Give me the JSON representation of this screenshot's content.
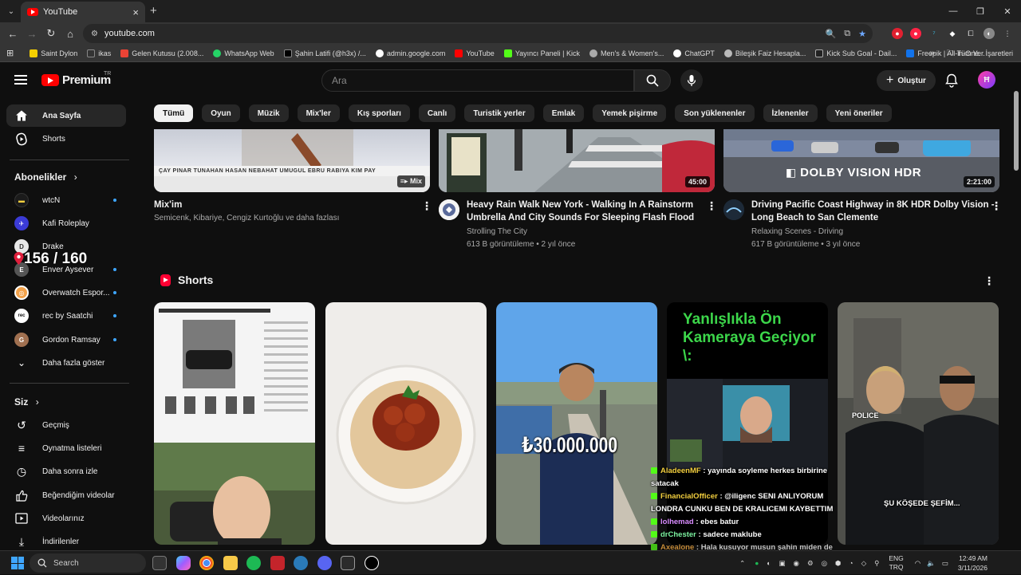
{
  "browser": {
    "tab_title": "YouTube",
    "url": "youtube.com",
    "bookmarks": [
      "Saint Dylon",
      "ikas",
      "Gelen Kutusu (2.008...",
      "WhatsApp Web",
      "Şahin Latifi (@h3x) /...",
      "admin.google.com",
      "YouTube",
      "Yayıncı Paneli | Kick",
      "Men's & Women's...",
      "ChatGPT",
      "Bileşik Faiz Hesapla...",
      "Kick Sub Goal - Dail...",
      "Freepik | All-in-One..."
    ],
    "bookmarks_more": "»",
    "all_bookmarks": "Tüm Yer İşaretleri",
    "colors": {
      "chrome_dark": "#1f1f1f",
      "chrome_mid": "#353535"
    }
  },
  "header": {
    "logo_text": "Premium",
    "logo_region": "TR",
    "search_placeholder": "Ara",
    "create_label": "Oluştur",
    "avatar_letter": "Ħ"
  },
  "sidebar": {
    "main": [
      {
        "label": "Ana Sayfa",
        "icon": "home-icon"
      },
      {
        "label": "Shorts",
        "icon": "shorts-icon"
      }
    ],
    "subs_heading": "Abonelikler",
    "subs": [
      {
        "label": "wtcN",
        "color": "#1b1b1b",
        "ch": "▬"
      },
      {
        "label": "Kafi Roleplay",
        "color": "#3b3bd6",
        "ch": "K"
      },
      {
        "label": "Drake",
        "color": "#e8e8e8",
        "ch": "D"
      },
      {
        "label": "Enver Aysever",
        "color": "#555",
        "ch": "E"
      },
      {
        "label": "Overwatch Espor...",
        "color": "#f3a24a",
        "ch": "O"
      },
      {
        "label": "rec by Saatchi",
        "color": "#ffffff",
        "ch": "rec"
      },
      {
        "label": "Gordon Ramsay",
        "color": "#a07050",
        "ch": "G"
      }
    ],
    "show_more": "Daha fazla göster",
    "you_heading": "Siz",
    "you": [
      {
        "label": "Geçmiş",
        "icon": "history-icon",
        "g": "↻"
      },
      {
        "label": "Oynatma listeleri",
        "icon": "playlist-icon",
        "g": "≡"
      },
      {
        "label": "Daha sonra izle",
        "icon": "clock-icon",
        "g": "◷"
      },
      {
        "label": "Beğendiğim videolar",
        "icon": "like-icon",
        "g": "👍"
      },
      {
        "label": "Videolarınız",
        "icon": "video-icon",
        "g": "▶"
      },
      {
        "label": "İndirilenler",
        "icon": "download-icon",
        "g": "⤓"
      }
    ],
    "counter": "156 / 160"
  },
  "chips": [
    "Tümü",
    "Oyun",
    "Müzik",
    "Mix'ler",
    "Kış sporları",
    "Canlı",
    "Turistik yerler",
    "Emlak",
    "Yemek pişirme",
    "Son yüklenenler",
    "İzlenenler",
    "Yeni öneriler"
  ],
  "videos": [
    {
      "title": "Mix'im",
      "title2": "",
      "channel": "Semicenk, Kibariye, Cengiz Kurtoğlu ve daha fazlası",
      "meta": "",
      "badge": "Mix",
      "thumb_text": "ÇAY PINAR TUNAHAN HASAN NEBAHAT UMUGUL EBRU RABIYA KIM PAY"
    },
    {
      "title": "Heavy Rain Walk New York - Walking In A Rainstorm",
      "title2": "Umbrella And City Sounds For Sleeping Flash Flood",
      "channel": "Strolling The City",
      "meta": "613 B görüntüleme • 2 yıl önce",
      "badge": "45:00"
    },
    {
      "title": "Driving Pacific Coast Highway in 8K HDR Dolby Vision -",
      "title2": "Long Beach to San Clemente",
      "channel": "Relaxing Scenes - Driving",
      "meta": "617 B görüntüleme • 3 yıl önce",
      "badge": "2:21:00",
      "thumb_text": "DOLBY VISION HDR"
    }
  ],
  "shorts": {
    "heading": "Shorts",
    "items": [
      {
        "overlay": "",
        "c1": "#e9e9e9",
        "c2": "#5a6a4a"
      },
      {
        "overlay": "",
        "c1": "#f2f0ee",
        "c2": "#d8d2c8"
      },
      {
        "overlay": "₺30.000.000",
        "c1": "#5aa0e8",
        "c2": "#6f7f66"
      },
      {
        "overlay": "Yanlışlıkla Ön Kameraya Geçiyor \\:",
        "c1": "#000000",
        "c2": "#222"
      },
      {
        "overlay": "ŞU KÖŞEDE ŞEFİM...",
        "c1": "#6a6a66",
        "c2": "#3a3a38"
      }
    ]
  },
  "chat": [
    {
      "user": "AladeenMF",
      "msg": ": yayında soyleme herkes birbirine satacak",
      "color": "#f4d03f"
    },
    {
      "user": "FinancialOfficer",
      "msg": ": @iligenc SENI ANLIYORUM LONDRA CUNKU BEN DE KRALICEMI KAYBETTIM",
      "color": "#f4d03f"
    },
    {
      "user": "lolhemad",
      "msg": ": ebes batur",
      "color": "#d98cff"
    },
    {
      "user": "drChester",
      "msg": ": sadece maklube",
      "color": "#7cf2a0"
    },
    {
      "user": "Axealone",
      "msg": ": Hala kusuyor musun şahin miden de sıkıntı var mı",
      "color": "#ffb347"
    }
  ],
  "taskbar": {
    "search": "Search",
    "lang1": "ENG",
    "lang2": "TRQ",
    "time": "12:49 AM",
    "date": "3/11/2026"
  }
}
